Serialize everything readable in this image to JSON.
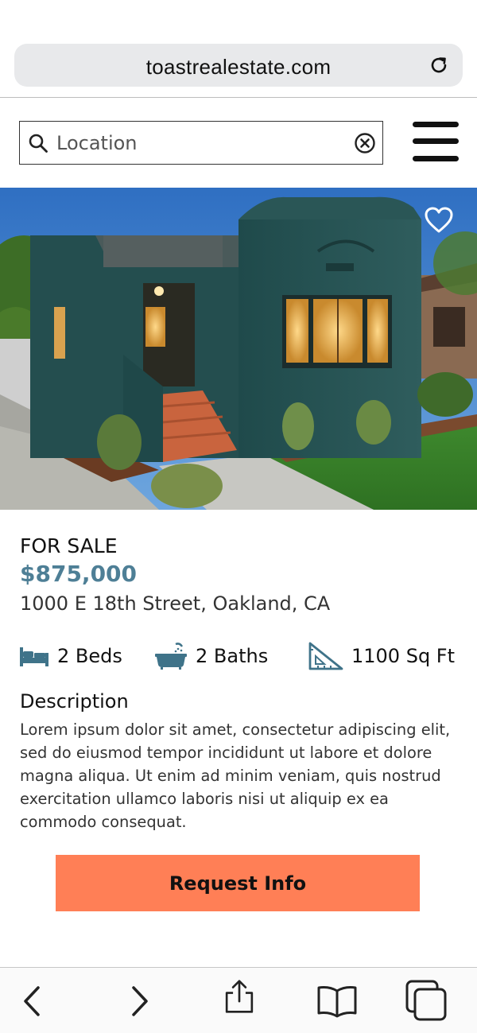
{
  "browser": {
    "url": "toastrealestate.com",
    "icons": {
      "reload": "reload-icon"
    }
  },
  "search": {
    "placeholder": "Location",
    "value": "",
    "icons": {
      "search": "search-icon",
      "clear": "clear-circle-icon",
      "menu": "hamburger-menu-icon"
    }
  },
  "listing": {
    "favorite_icon": "heart-outline-icon",
    "status": "FOR SALE",
    "price": "$875,000",
    "address": "1000 E 18th Street, Oakland, CA",
    "features": [
      {
        "icon": "bed-icon",
        "label": "2 Beds"
      },
      {
        "icon": "bathtub-icon",
        "label": "2 Baths"
      },
      {
        "icon": "ruler-triangle-icon",
        "label": "1100 Sq Ft"
      }
    ],
    "description_title": "Description",
    "description": "Lorem ipsum dolor sit amet, consectetur adipiscing elit, sed do eiusmod tempor incididunt ut labore et dolore magna aliqua. Ut enim ad minim veniam, quis nostrud exercitation ullamco laboris nisi ut aliquip ex ea commodo consequat.",
    "cta_label": "Request Info"
  },
  "toolbar": {
    "items": [
      "back-icon",
      "forward-icon",
      "share-icon",
      "bookmarks-icon",
      "tabs-icon"
    ]
  },
  "colors": {
    "accent_price": "#4e7f96",
    "cta_background": "#ff7f56",
    "icon_teal": "#3f7389"
  }
}
